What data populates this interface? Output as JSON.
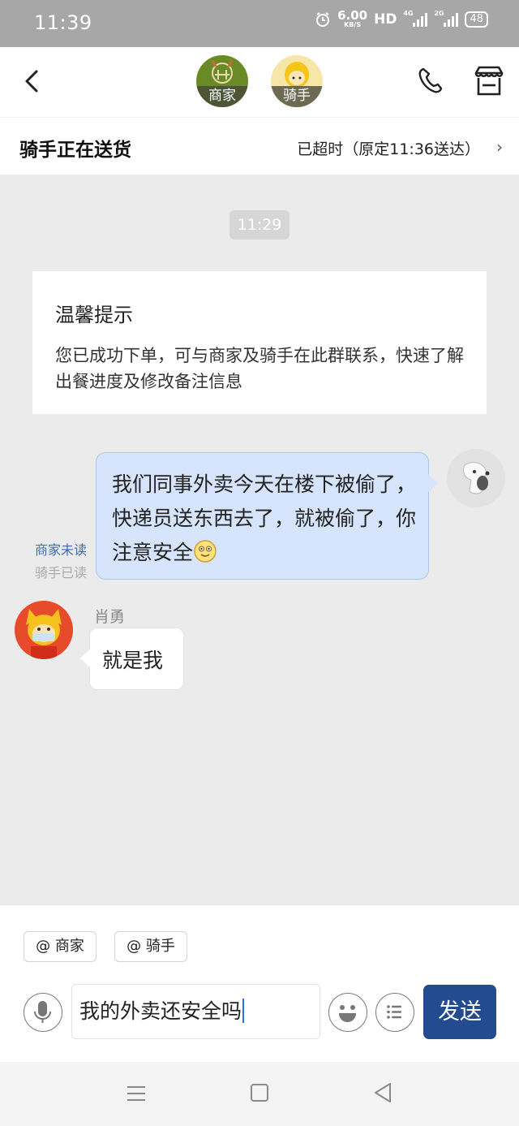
{
  "status_bar": {
    "time": "11:39",
    "net_speed_value": "6.00",
    "net_speed_unit": "KB/S",
    "hd": "HD",
    "sim1": "4G",
    "sim2": "2G",
    "battery": "48"
  },
  "header": {
    "merchant_label": "商家",
    "rider_label": "骑手"
  },
  "delivery": {
    "title": "骑手正在送货",
    "eta": "已超时（原定11:36送达）"
  },
  "chat": {
    "time_chip": "11:29",
    "notice_title": "温馨提示",
    "notice_body": "您已成功下单，可与商家及骑手在此群联系，快速了解出餐进度及修改备注信息",
    "my_message": "我们同事外卖今天在楼下被偷了，快递员送东西去了，就被偷了，你注意安全",
    "read_merchant": "商家未读",
    "read_rider": "骑手已读",
    "rider_name": "肖勇",
    "rider_message": "就是我"
  },
  "input": {
    "at_merchant": "@ 商家",
    "at_rider": "@ 骑手",
    "text": "我的外卖还安全吗",
    "send": "发送"
  },
  "colors": {
    "accent": "#234b8f",
    "my_bubble": "#d6e5fb",
    "read_blue": "#3e6cb8"
  }
}
